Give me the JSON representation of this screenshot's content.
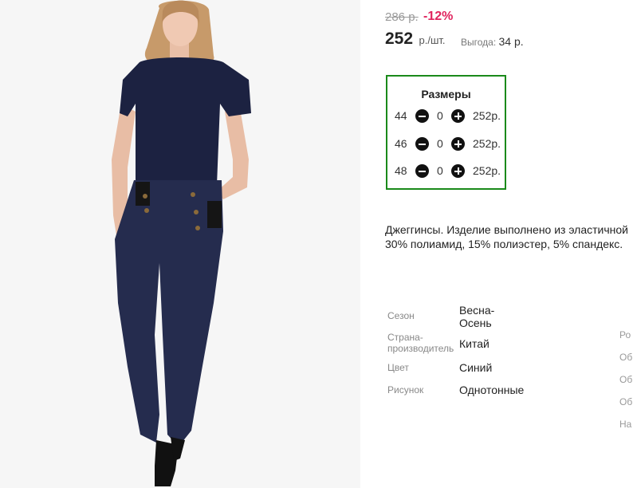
{
  "price": {
    "old": "286 р.",
    "discount": "-12%",
    "current": "252",
    "unit": "р./шт.",
    "savings_label": "Выгода:",
    "savings_value": "34 р."
  },
  "sizes": {
    "title": "Размеры",
    "rows": [
      {
        "size": "44",
        "qty": "0",
        "price": "252р."
      },
      {
        "size": "46",
        "qty": "0",
        "price": "252р."
      },
      {
        "size": "48",
        "qty": "0",
        "price": "252р."
      }
    ]
  },
  "description": {
    "line1": "Джеггинсы. Изделие выполнено из эластичной",
    "line2": "30% полиамид, 15% полиэстер, 5% спандекс."
  },
  "specs": [
    {
      "label": "Сезон",
      "value": "Весна-Осень"
    },
    {
      "label": "Страна-производитель",
      "value": "Китай"
    },
    {
      "label": "Цвет",
      "value": "Синий"
    },
    {
      "label": "Рисунок",
      "value": "Однотонные"
    }
  ],
  "spec_layout": {
    "season_value_line1": "Весна-",
    "season_value_line2": "Осень",
    "country_label_line1": "Страна-",
    "country_label_line2": "производитель"
  },
  "right_column": [
    "Ро",
    "Об",
    "Об",
    "Об",
    "На"
  ]
}
